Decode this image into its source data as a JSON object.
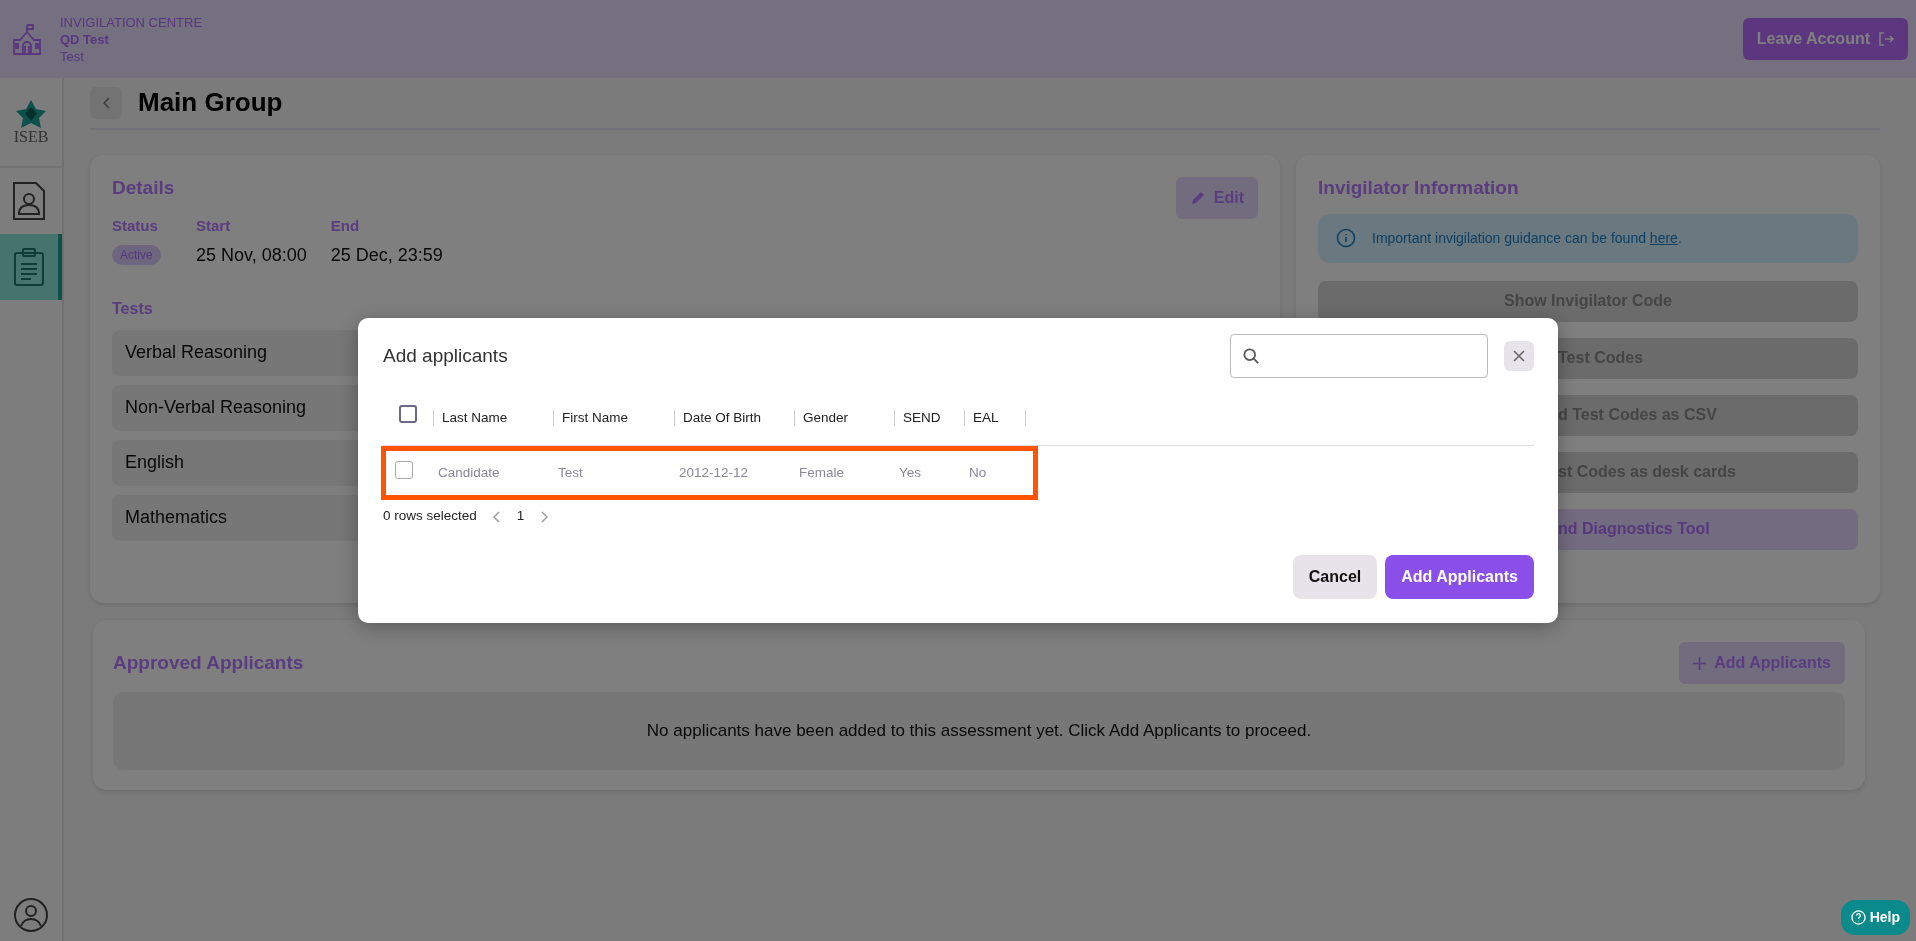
{
  "header": {
    "section_label": "INVIGILATION CENTRE",
    "centre_name": "QD Test",
    "subtitle": "Test",
    "leave_button": "Leave Account"
  },
  "sidebar": {
    "logo_text": "ISEB",
    "items": [
      {
        "kind": "profile",
        "selected": false
      },
      {
        "kind": "clipboard",
        "selected": true
      }
    ]
  },
  "page": {
    "title": "Main Group"
  },
  "details": {
    "title": "Details",
    "edit_label": "Edit",
    "fields": [
      {
        "label": "Status",
        "value": "Active",
        "kind": "badge"
      },
      {
        "label": "Start",
        "value": "25 Nov, 08:00",
        "kind": "text"
      },
      {
        "label": "End",
        "value": "25 Dec, 23:59",
        "kind": "text"
      }
    ],
    "tests_heading": "Tests",
    "tests": [
      "Verbal Reasoning",
      "Non-Verbal Reasoning",
      "English",
      "Mathematics"
    ]
  },
  "invigilator": {
    "title": "Invigilator Information",
    "info_text": "Important invigilation guidance can be found ",
    "info_link": "here",
    "info_end": ".",
    "buttons": [
      {
        "label": "Show Invigilator Code",
        "kind": "plain",
        "cut": false
      },
      {
        "label": "Test Codes",
        "kind": "plain",
        "cut": true
      },
      {
        "label": "d Test Codes as CSV",
        "kind": "plain",
        "cut": true
      },
      {
        "label": "st Codes as desk cards",
        "kind": "plain",
        "cut": true
      },
      {
        "label": "nd Diagnostics Tool",
        "kind": "accent",
        "cut": true
      }
    ]
  },
  "approved": {
    "title": "Approved Applicants",
    "add_label": "Add Applicants",
    "empty_message": "No applicants have been added to this assessment yet. Click Add Applicants to proceed."
  },
  "modal": {
    "title": "Add applicants",
    "select_all": {
      "checked": false
    },
    "columns": [
      "Last Name",
      "First Name",
      "Date Of Birth",
      "Gender",
      "SEND",
      "EAL"
    ],
    "rows": [
      {
        "cells": [
          "Candidate",
          "Test",
          "2012-12-12",
          "Female",
          "Yes",
          "No"
        ],
        "checked": false,
        "highlighted": true
      }
    ],
    "selection_text": "0 rows selected",
    "page": "1",
    "cancel_label": "Cancel",
    "confirm_label": "Add Applicants"
  },
  "help": {
    "label": "Help"
  }
}
